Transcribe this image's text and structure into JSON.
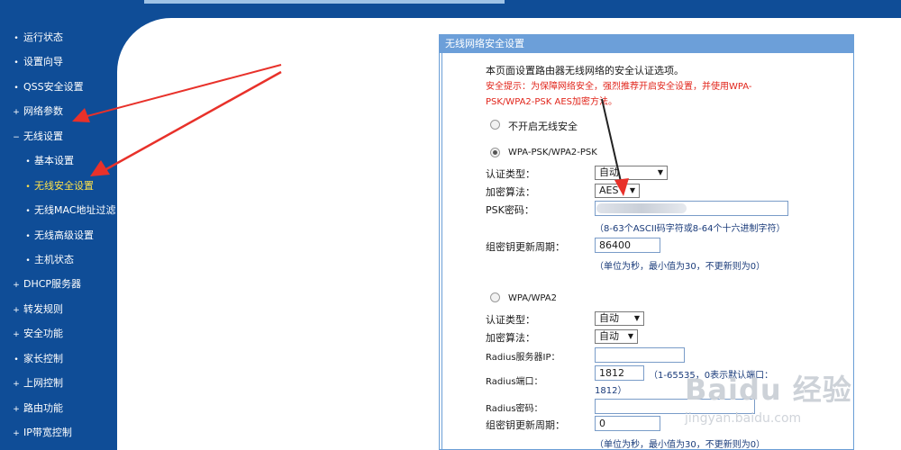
{
  "sidebar": {
    "items": [
      {
        "label": "运行状态",
        "marker": "•"
      },
      {
        "label": "设置向导",
        "marker": "•"
      },
      {
        "label": "QSS安全设置",
        "marker": "•"
      },
      {
        "label": "网络参数",
        "marker": "+"
      },
      {
        "label": "无线设置",
        "marker": "−"
      },
      {
        "label": "基本设置",
        "marker": "•"
      },
      {
        "label": "无线安全设置",
        "marker": "•"
      },
      {
        "label": "无线MAC地址过滤",
        "marker": "•"
      },
      {
        "label": "无线高级设置",
        "marker": "•"
      },
      {
        "label": "主机状态",
        "marker": "•"
      },
      {
        "label": "DHCP服务器",
        "marker": "+"
      },
      {
        "label": "转发规则",
        "marker": "+"
      },
      {
        "label": "安全功能",
        "marker": "+"
      },
      {
        "label": "家长控制",
        "marker": "•"
      },
      {
        "label": "上网控制",
        "marker": "+"
      },
      {
        "label": "路由功能",
        "marker": "+"
      },
      {
        "label": "IP带宽控制",
        "marker": "+"
      }
    ]
  },
  "panel": {
    "title": "无线网络安全设置",
    "intro": "本页面设置路由器无线网络的安全认证选项。",
    "tip_line1": "安全提示：为保障网络安全，强烈推荐开启安全设置，并使用WPA-",
    "tip_line2": "PSK/WPA2-PSK AES加密方法。",
    "option_none": {
      "label": "不开启无线安全",
      "selected": false
    },
    "option_psk": {
      "label": "WPA-PSK/WPA2-PSK",
      "selected": true,
      "auth_label": "认证类型：",
      "auth_value": "自动",
      "enc_label": "加密算法：",
      "enc_value": "AES",
      "psk_label": "PSK密码：",
      "psk_hint": "（8-63个ASCII码字符或8-64个十六进制字符）",
      "renew_label": "组密钥更新周期：",
      "renew_value": "86400",
      "renew_hint": "（单位为秒，最小值为30，不更新则为0）"
    },
    "option_wpa": {
      "label": "WPA/WPA2",
      "selected": false,
      "auth_label": "认证类型：",
      "auth_value": "自动",
      "enc_label": "加密算法：",
      "enc_value": "自动",
      "radius_ip_label": "Radius服务器IP：",
      "radius_ip_value": "",
      "radius_port_label": "Radius端口：",
      "radius_port_value": "1812",
      "radius_port_hint": "（1-65535，0表示默认端口：",
      "radius_port_hint2": "1812）",
      "radius_pwd_label": "Radius密码：",
      "radius_pwd_value": "",
      "renew_label": "组密钥更新周期：",
      "renew_value": "0",
      "renew_hint": "（单位为秒，最小值为30，不更新则为0）"
    }
  },
  "watermark": {
    "text": "Baidu 经验",
    "url": "jingyan.baidu.com"
  },
  "colors": {
    "nav_bg": "#0f4d97",
    "header_bg": "#6c9fd9",
    "active": "#ffe24a",
    "warning": "#e1251b",
    "arrow": "#e8312a"
  }
}
